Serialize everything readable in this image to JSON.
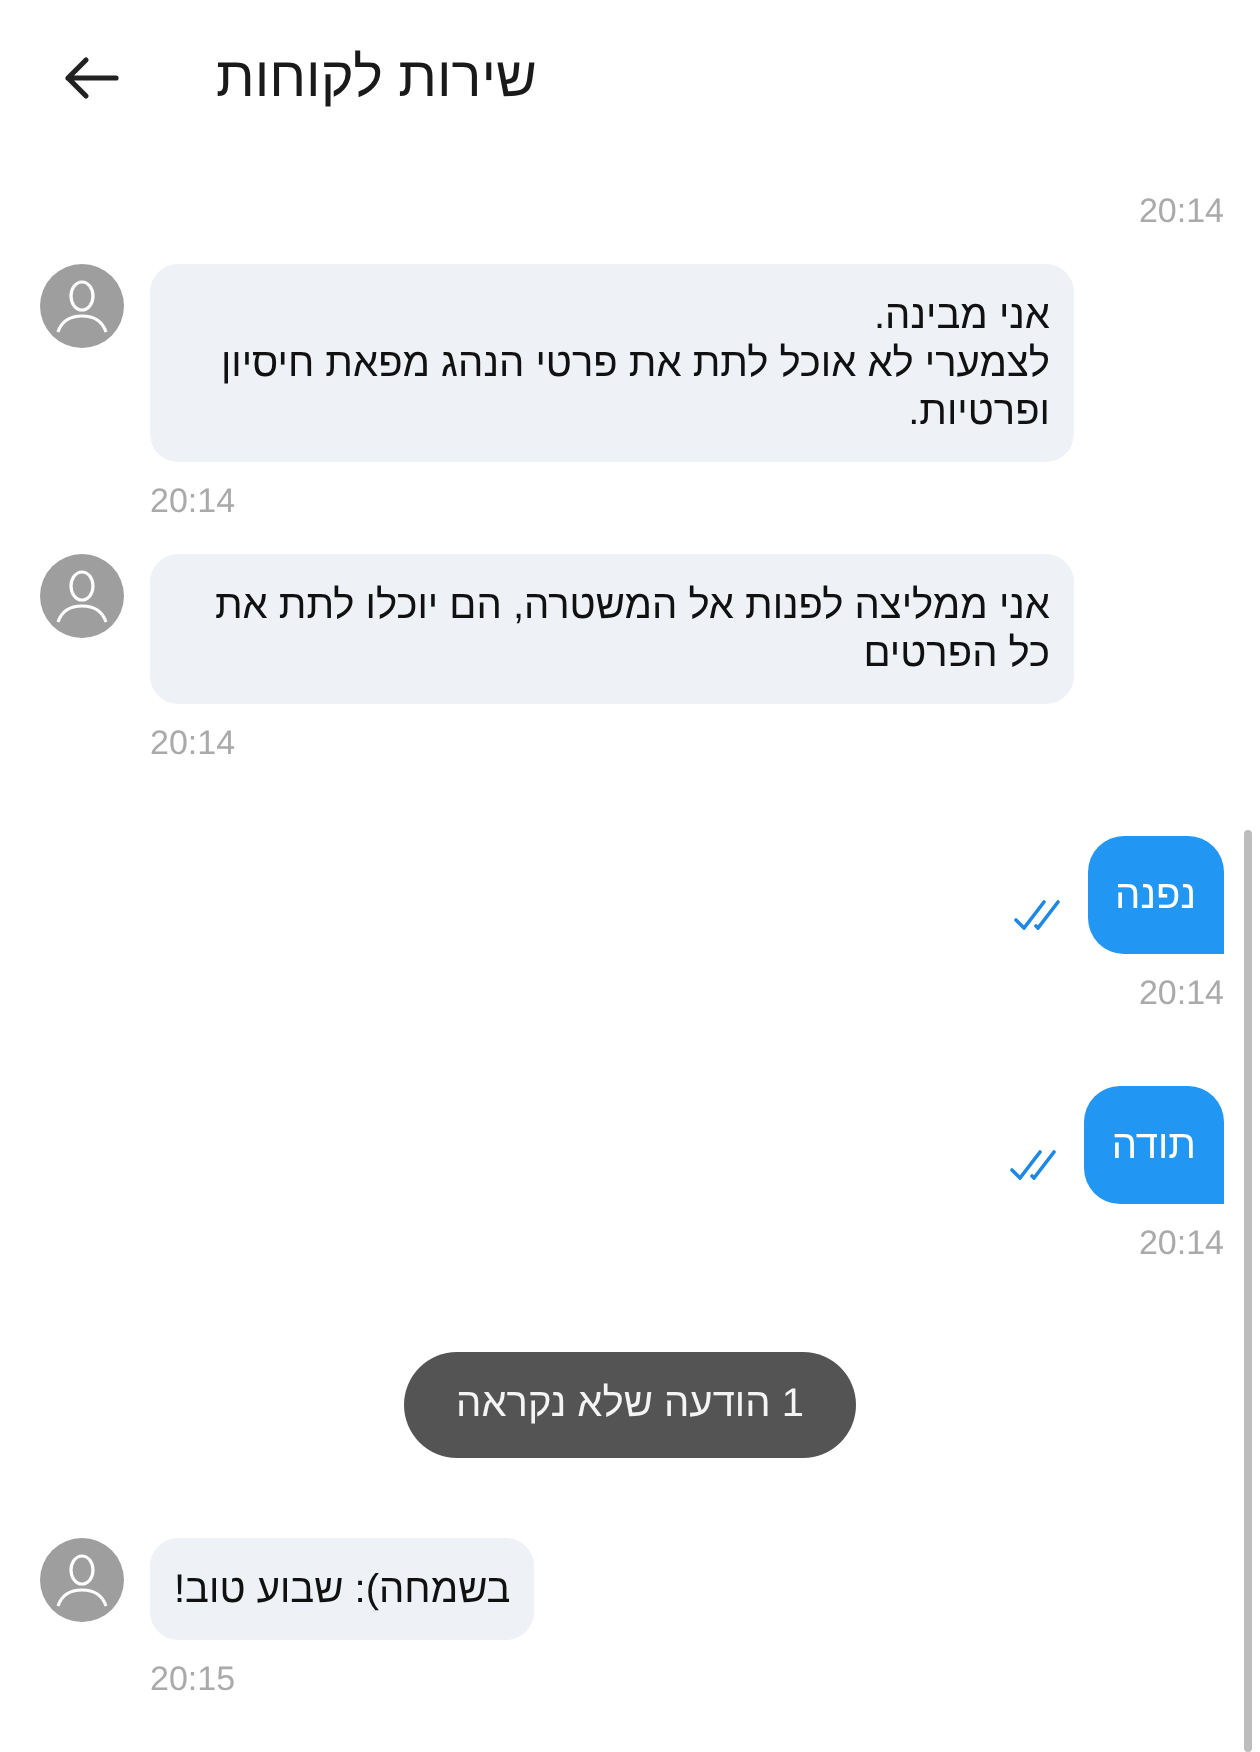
{
  "header": {
    "title": "שירות לקוחות"
  },
  "messages": [
    {
      "kind": "time",
      "time": "20:14"
    },
    {
      "kind": "incoming",
      "text": "אני מבינה.\nלצמערי לא אוכל לתת את פרטי הנהג מפאת חיסיון ופרטיות.",
      "time": "20:14"
    },
    {
      "kind": "incoming",
      "text": "אני ממליצה לפנות אל המשטרה, הם יוכלו לתת את כל הפרטים",
      "time": "20:14"
    },
    {
      "kind": "outgoing",
      "text": "נפנה",
      "read": true,
      "time": "20:14"
    },
    {
      "kind": "outgoing",
      "text": "תודה",
      "read": true,
      "time": "20:14"
    },
    {
      "kind": "notice",
      "text": "1 הודעה שלא נקראה"
    },
    {
      "kind": "incoming",
      "text": "בשמחה): שבוע טוב!",
      "time": "20:15"
    }
  ]
}
